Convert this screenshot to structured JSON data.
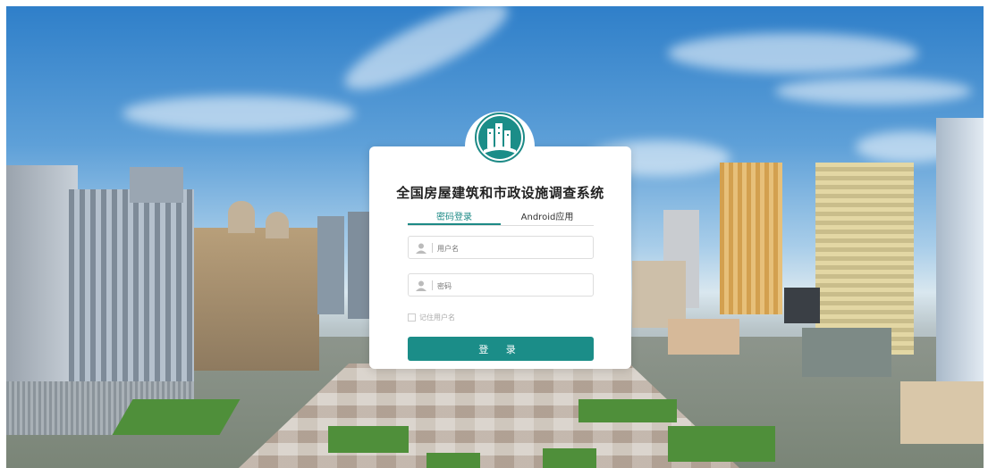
{
  "system": {
    "title": "全国房屋建筑和市政设施调查系统",
    "accent_color": "#1b8d88"
  },
  "tabs": {
    "items": [
      {
        "label": "密码登录",
        "active": true
      },
      {
        "label": "Android应用",
        "active": false
      }
    ]
  },
  "form": {
    "username": {
      "placeholder": "用户名",
      "value": "",
      "icon": "user-icon"
    },
    "password": {
      "placeholder": "密码",
      "value": "",
      "icon": "user-icon"
    },
    "remember_label": "记住用户名",
    "remember_checked": false,
    "login_label": "登 录"
  },
  "logo": {
    "icon": "city-buildings-logo-icon"
  }
}
